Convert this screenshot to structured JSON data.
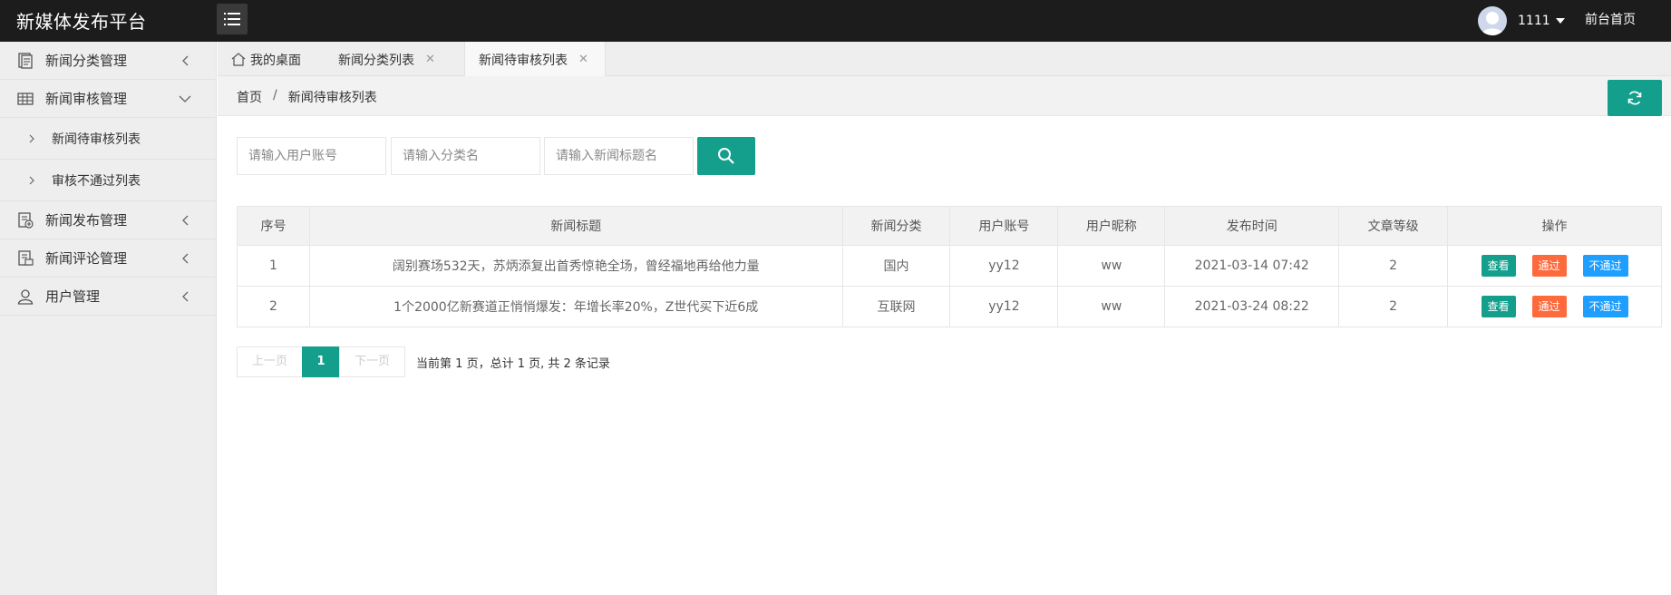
{
  "header": {
    "logo": "新媒体发布平台",
    "username": "1111",
    "front_home": "前台首页"
  },
  "sidebar": {
    "items": [
      {
        "label": "新闻分类管理"
      },
      {
        "label": "新闻审核管理"
      },
      {
        "label": "新闻待审核列表"
      },
      {
        "label": "审核不通过列表"
      },
      {
        "label": "新闻发布管理"
      },
      {
        "label": "新闻评论管理"
      },
      {
        "label": "用户管理"
      }
    ]
  },
  "tabs": [
    {
      "label": "我的桌面"
    },
    {
      "label": "新闻分类列表"
    },
    {
      "label": "新闻待审核列表"
    }
  ],
  "breadcrumb": {
    "home": "首页",
    "sep": "/",
    "current": "新闻待审核列表"
  },
  "search": {
    "account_placeholder": "请输入用户账号",
    "category_placeholder": "请输入分类名",
    "title_placeholder": "请输入新闻标题名"
  },
  "table": {
    "headers": [
      "序号",
      "新闻标题",
      "新闻分类",
      "用户账号",
      "用户昵称",
      "发布时间",
      "文章等级",
      "操作"
    ],
    "rows": [
      {
        "no": "1",
        "title": "阔别赛场532天，苏炳添复出首秀惊艳全场，曾经福地再给他力量",
        "category": "国内",
        "account": "yy12",
        "nickname": "ww",
        "time": "2021-03-14 07:42",
        "level": "2"
      },
      {
        "no": "2",
        "title": "1个2000亿新赛道正悄悄爆发：年增长率20%，Z世代买下近6成",
        "category": "互联网",
        "account": "yy12",
        "nickname": "ww",
        "time": "2021-03-24 08:22",
        "level": "2"
      }
    ],
    "actions": {
      "view": "查看",
      "pass": "通过",
      "reject": "不通过"
    }
  },
  "pagination": {
    "prev": "上一页",
    "current": "1",
    "next": "下一页",
    "info": "当前第 1 页，总计 1 页, 共 2 条记录"
  },
  "colors": {
    "accent": "#149f8c",
    "header_bg": "#1c1c1c",
    "pass": "#ff6a3d",
    "reject": "#1e9fff"
  }
}
